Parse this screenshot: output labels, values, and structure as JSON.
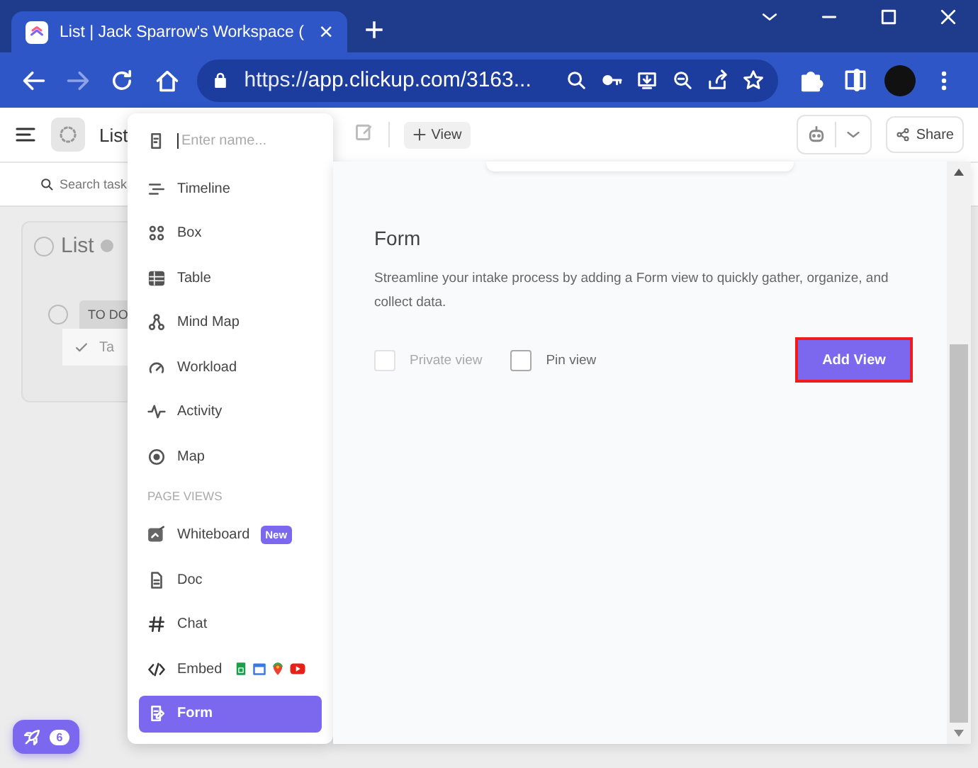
{
  "browser": {
    "tab": {
      "title": "List | Jack Sparrow's Workspace (",
      "close": "×",
      "selected": true
    },
    "new_tab": "+",
    "url": "https://app.clickup.com/3163..."
  },
  "app_bar": {
    "title": "List",
    "add_view": "View",
    "share": "Share"
  },
  "search": {
    "placeholder": "Search task"
  },
  "list_card": {
    "title": "List",
    "status": "TO DO",
    "task": "Ta"
  },
  "view_menu": {
    "name_placeholder": "Enter name...",
    "items": [
      {
        "kind": "item",
        "label": "Timeline",
        "selected": false
      },
      {
        "kind": "item",
        "label": "Box",
        "selected": false
      },
      {
        "kind": "item",
        "label": "Table",
        "selected": false
      },
      {
        "kind": "item",
        "label": "Mind Map",
        "selected": false
      },
      {
        "kind": "item",
        "label": "Workload",
        "selected": false
      },
      {
        "kind": "item",
        "label": "Activity",
        "selected": false
      },
      {
        "kind": "item",
        "label": "Map",
        "selected": false
      },
      {
        "kind": "heading",
        "label": "PAGE VIEWS"
      },
      {
        "kind": "item",
        "label": "Whiteboard",
        "badge": "New",
        "selected": false
      },
      {
        "kind": "item",
        "label": "Doc",
        "selected": false
      },
      {
        "kind": "item",
        "label": "Chat",
        "selected": false
      },
      {
        "kind": "embed",
        "label": "Embed",
        "selected": false
      },
      {
        "kind": "item",
        "label": "Form",
        "selected": true
      }
    ]
  },
  "form_panel": {
    "title": "Form",
    "description": "Streamline your intake process by adding a Form view to quickly gather, organize, and collect data.",
    "options": [
      {
        "label": "Private view",
        "checked": false,
        "disabled": true
      },
      {
        "label": "Pin view",
        "checked": false,
        "disabled": false
      }
    ],
    "button": "Add View"
  },
  "launcher": {
    "count": "6"
  }
}
